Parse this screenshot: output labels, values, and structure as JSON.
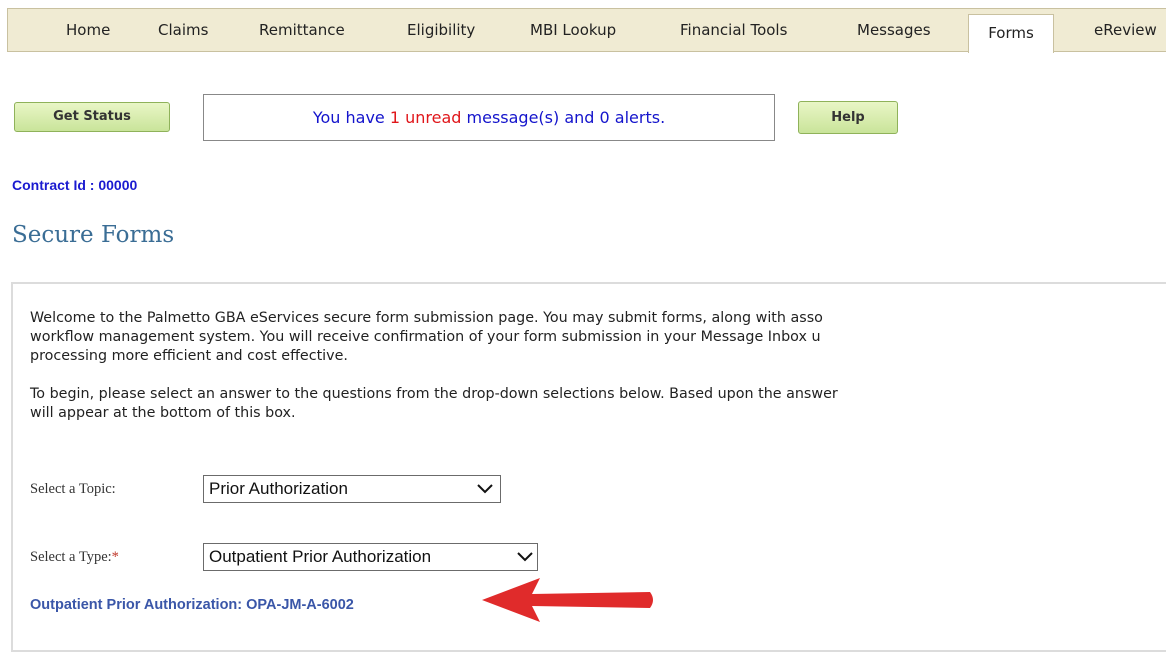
{
  "nav": {
    "tabs": [
      {
        "label": "Home"
      },
      {
        "label": "Claims"
      },
      {
        "label": "Remittance"
      },
      {
        "label": "Eligibility"
      },
      {
        "label": "MBI Lookup"
      },
      {
        "label": "Financial Tools"
      },
      {
        "label": "Messages"
      },
      {
        "label": "Forms"
      },
      {
        "label": "eReview"
      }
    ],
    "active": "Forms"
  },
  "toolbar": {
    "get_status_label": "Get Status",
    "help_label": "Help"
  },
  "message": {
    "prefix": "You have ",
    "count": "1",
    "unread_word": " unread",
    "suffix": " message(s) and 0 alerts."
  },
  "contract": {
    "label": "Contract Id : 00000"
  },
  "page": {
    "title": "Secure Forms"
  },
  "intro": {
    "line1": "Welcome to the Palmetto GBA eServices secure form submission page. You may submit forms, along with asso",
    "line2": "workflow management system. You will receive confirmation of your form submission in your Message Inbox u",
    "line3": "processing more efficient and cost effective.",
    "line4": "To begin, please select an answer to the questions from the drop-down selections below. Based upon the answer",
    "line5": "will appear at the bottom of this box."
  },
  "form": {
    "topic_label": "Select a Topic:",
    "topic_value": "Prior Authorization",
    "type_label": "Select a Type:",
    "type_required_mark": "*",
    "type_value": "Outpatient Prior Authorization"
  },
  "result": {
    "link_text": "Outpatient Prior Authorization: OPA-JM-A-6002"
  },
  "colors": {
    "nav_bg": "#f0ebd3",
    "button_green": "#c9e49a",
    "message_blue": "#1414cc",
    "unread_red": "#e0161a",
    "title_blue": "#3a6d95",
    "link_blue": "#3a56a8",
    "arrow_red": "#e02b2b"
  },
  "icons": {
    "select_chevron": "chevron-down-icon",
    "annotation_arrow": "arrow-left-icon"
  }
}
